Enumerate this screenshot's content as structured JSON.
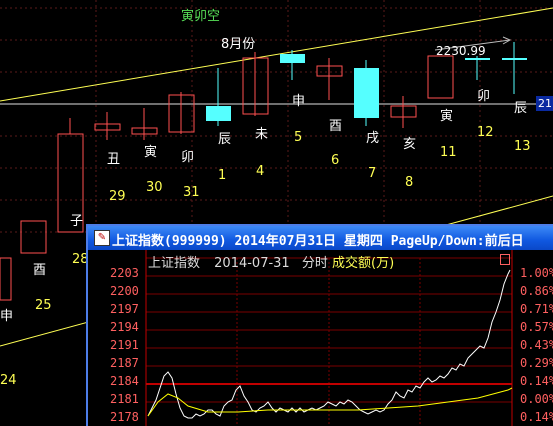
{
  "kline": {
    "top_label": "寅卯空",
    "month_label": "8月份",
    "price_label": "2230.99",
    "right_edge_value": "21",
    "zodiac": [
      "申",
      "酉",
      "子",
      "丑",
      "寅",
      "卯",
      "辰",
      "未",
      "申",
      "酉",
      "戌",
      "亥",
      "寅",
      "卯",
      "辰"
    ],
    "dates": [
      "24",
      "25",
      "28",
      "29",
      "30",
      "31",
      "1",
      "4",
      "5",
      "6",
      "7",
      "8",
      "11",
      "12",
      "13"
    ]
  },
  "window": {
    "title": "上证指数(999999) 2014年07月31日 星期四 PageUp/Down:前后日 "
  },
  "intraday": {
    "name": "上证指数",
    "date": "2014-07-31",
    "mode": "分时",
    "volume_label": "成交额(万)",
    "y_left": [
      "2203",
      "2200",
      "2197",
      "2194",
      "2191",
      "2187",
      "2184",
      "2181",
      "2178"
    ],
    "y_right": [
      "1.00%",
      "0.86%",
      "0.71%",
      "0.57%",
      "0.43%",
      "0.29%",
      "0.14%",
      "0.00%",
      "0.14%"
    ],
    "colors": {
      "up": "#ff5050",
      "price_line": "#ffffff",
      "avg_line": "#ffff00",
      "grid": "#8b0000"
    }
  }
}
